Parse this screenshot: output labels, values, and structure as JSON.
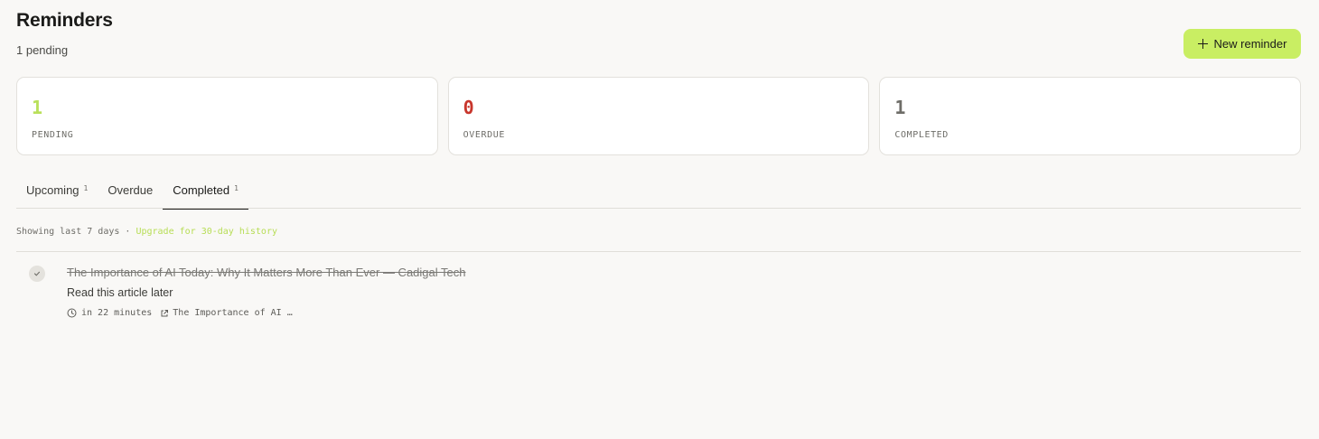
{
  "header": {
    "title": "Reminders",
    "subtitle": "1 pending",
    "new_button_label": "New reminder"
  },
  "stats": [
    {
      "value": "1",
      "label": "PENDING",
      "color": "#b9e05a"
    },
    {
      "value": "0",
      "label": "OVERDUE",
      "color": "#c8362c"
    },
    {
      "value": "1",
      "label": "COMPLETED",
      "color": "#6e6d68"
    }
  ],
  "tabs": [
    {
      "label": "Upcoming",
      "count": "1",
      "active": false
    },
    {
      "label": "Overdue",
      "count": "",
      "active": false
    },
    {
      "label": "Completed",
      "count": "1",
      "active": true
    }
  ],
  "info": {
    "text": "Showing last 7 days · ",
    "upgrade_link": "Upgrade for 30-day history"
  },
  "reminders": [
    {
      "title": "The Importance of AI Today: Why It Matters More Than Ever — Cadigal Tech",
      "note": "Read this article later",
      "due": "in 22 minutes",
      "link_text": "The Importance of AI …",
      "completed": true
    }
  ],
  "colors": {
    "accent": "#c9ee63",
    "accent_text": "#b7dd55",
    "background": "#f9f8f6"
  },
  "icons": {
    "new_button": "plus-icon",
    "check": "check-icon",
    "due": "clock-icon",
    "link": "external-link-icon"
  }
}
